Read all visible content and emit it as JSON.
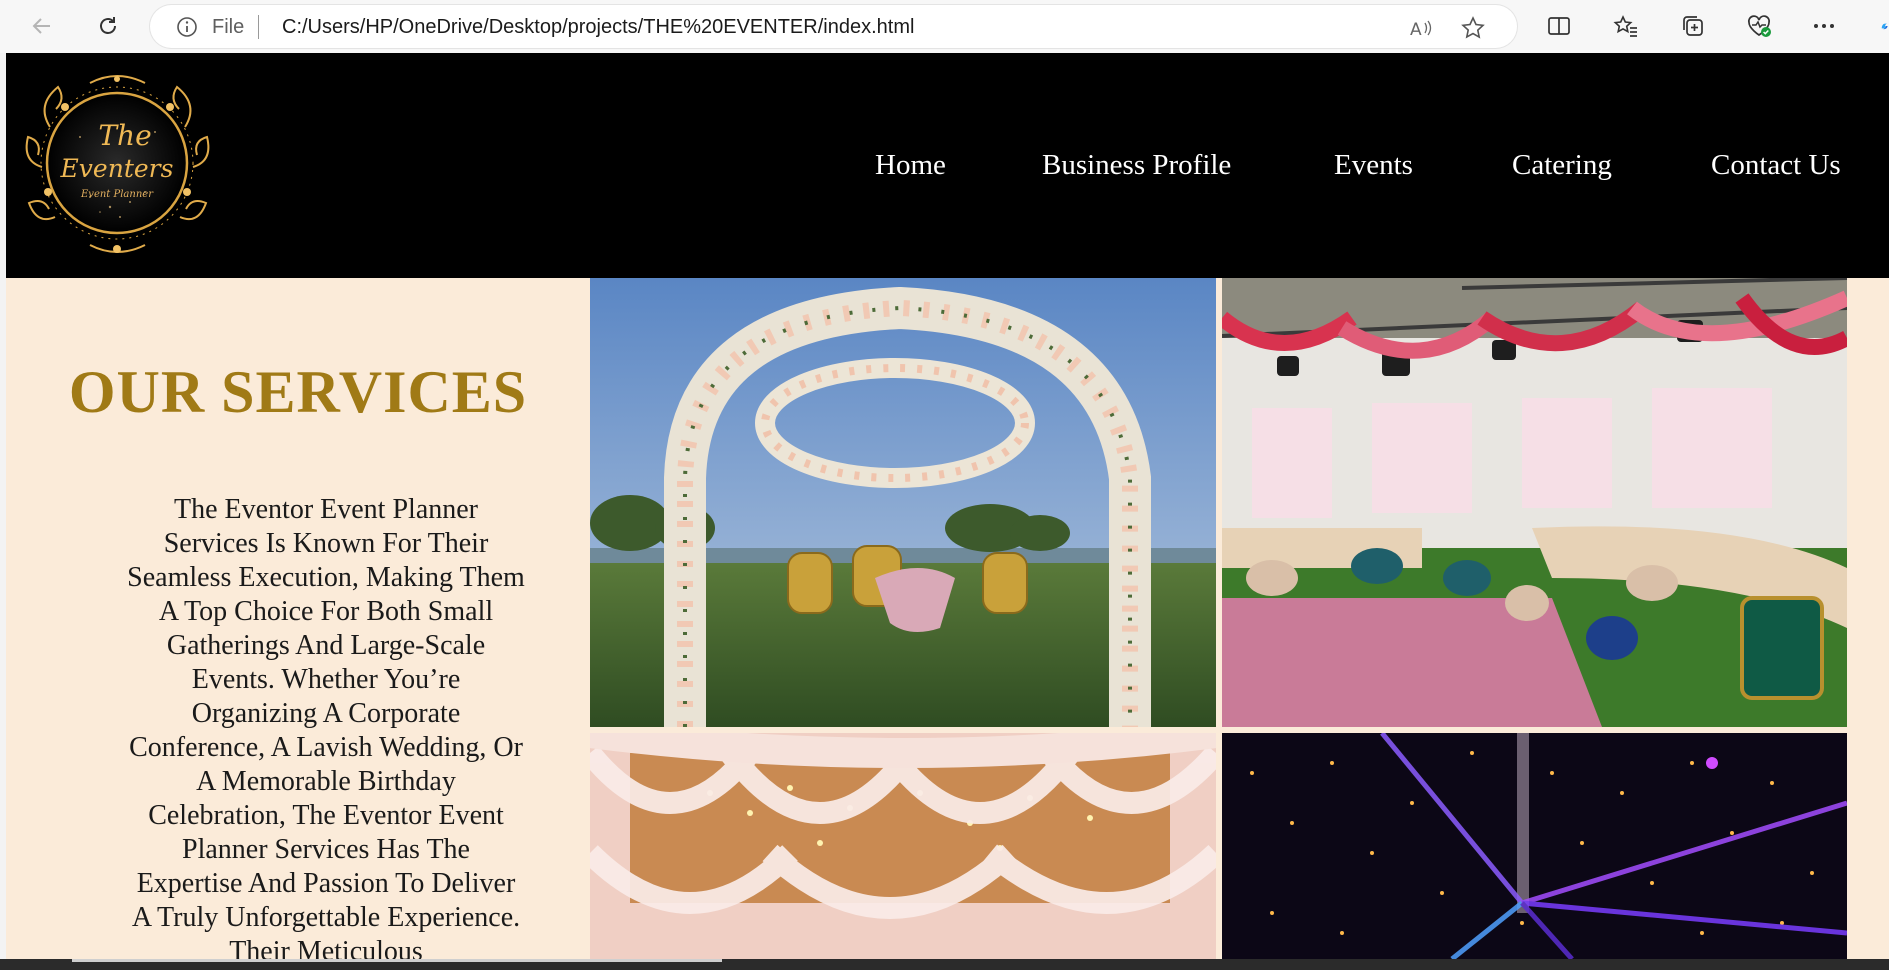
{
  "browser": {
    "address_prefix": "File",
    "url": "C:/Users/HP/OneDrive/Desktop/projects/THE%20EVENTER/index.html",
    "icons": [
      "back-icon",
      "refresh-icon",
      "info-icon",
      "read-aloud-icon",
      "favorite-star-icon",
      "split-screen-icon",
      "favorites-icon",
      "collections-icon",
      "browser-essentials-icon",
      "more-icon",
      "copilot-icon"
    ]
  },
  "site": {
    "logo": {
      "line1": "The",
      "line2": "Eventers",
      "line3": "Event Planner"
    },
    "nav": [
      {
        "label": "Home"
      },
      {
        "label": "Business Profile"
      },
      {
        "label": "Events"
      },
      {
        "label": "Catering"
      },
      {
        "label": "Contact Us"
      }
    ],
    "services": {
      "title": "OUR SERVICES",
      "body": "The Eventor Event Planner Services Is Known For Their Seamless Execution, Making Them A Top Choice For Both Small Gatherings And Large-Scale Events. Whether You’re Organizing A Corporate Conference, A Lavish Wedding, Or A Memorable Birthday Celebration, The Eventor Event Planner Services Has The Expertise And Passion To Deliver A Truly Unforgettable Experience. Their Meticulous"
    },
    "gallery": [
      {
        "subject": "floral-arch-stage"
      },
      {
        "subject": "draped-lounge-tent"
      },
      {
        "subject": "draped-ceiling-lights"
      },
      {
        "subject": "starry-light-show"
      }
    ]
  },
  "colors": {
    "header_bg": "#000000",
    "services_bg": "#fbebd9",
    "title_gold": "#a07a16",
    "nav_text": "#ffffff"
  }
}
